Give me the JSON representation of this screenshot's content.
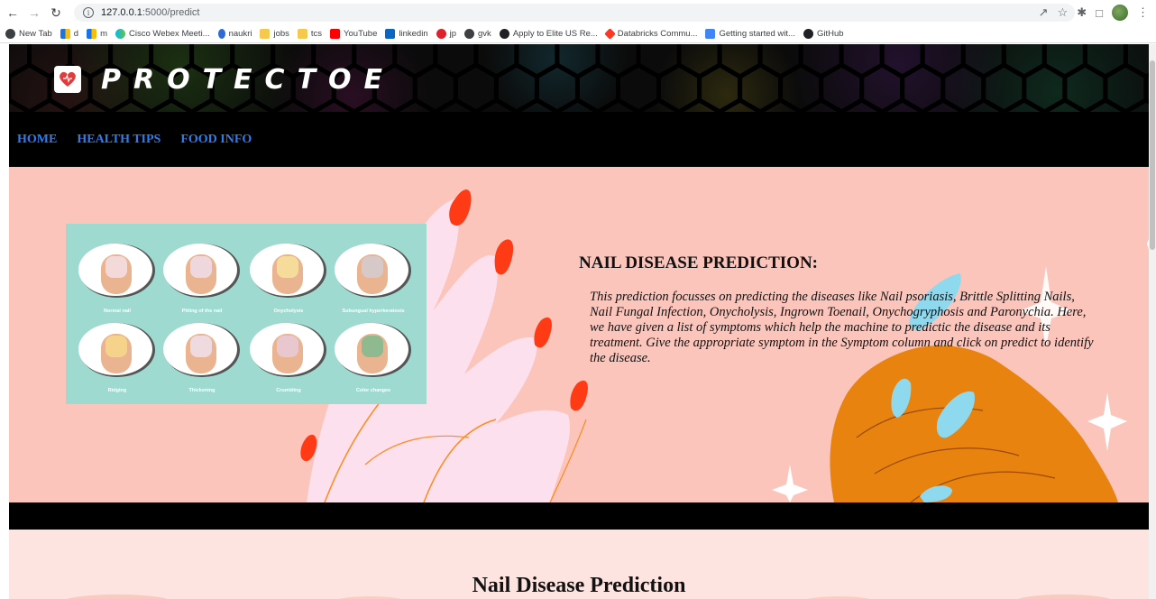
{
  "browser": {
    "url_host": "127.0.0.1",
    "url_path": ":5000/predict",
    "bookmarks": [
      {
        "label": "New Tab",
        "icon": "globe-icon",
        "cls": "globe"
      },
      {
        "label": "d",
        "icon": "meet-icon",
        "cls": "meet"
      },
      {
        "label": "m",
        "icon": "meet-icon",
        "cls": "meet"
      },
      {
        "label": "Cisco Webex Meeti...",
        "icon": "webex-icon",
        "cls": "webex"
      },
      {
        "label": "naukri",
        "icon": "naukri-icon",
        "cls": "naukri"
      },
      {
        "label": "jobs",
        "icon": "folder-icon",
        "cls": "folder"
      },
      {
        "label": "tcs",
        "icon": "folder-icon",
        "cls": "folder"
      },
      {
        "label": "YouTube",
        "icon": "youtube-icon",
        "cls": "youtube"
      },
      {
        "label": "linkedin",
        "icon": "linkedin-icon",
        "cls": "linkedin"
      },
      {
        "label": "jp",
        "icon": "opera-icon",
        "cls": "opera"
      },
      {
        "label": "gvk",
        "icon": "globe-icon",
        "cls": "chrome"
      },
      {
        "label": "Apply to Elite US Re...",
        "icon": "elite-icon",
        "cls": "elite"
      },
      {
        "label": "Databricks Commu...",
        "icon": "databricks-icon",
        "cls": "databricks"
      },
      {
        "label": "Getting started wit...",
        "icon": "docs-icon",
        "cls": "docs"
      },
      {
        "label": "GitHub",
        "icon": "github-icon",
        "cls": "github"
      }
    ]
  },
  "site": {
    "brand": "PROTECTOE",
    "nav": [
      {
        "label": "HOME"
      },
      {
        "label": "HEALTH TIPS"
      },
      {
        "label": "FOOD INFO"
      }
    ]
  },
  "nail_chart": {
    "items": [
      {
        "caption": "Normal nail",
        "nail_color": "#f3d9d9"
      },
      {
        "caption": "Pitting of the nail",
        "nail_color": "#efd8dd"
      },
      {
        "caption": "Onycholysis",
        "nail_color": "#f6dc9a"
      },
      {
        "caption": "Subungual hyperkeratosis",
        "nail_color": "#d8c9c9"
      },
      {
        "caption": "Ridging",
        "nail_color": "#f5d38a"
      },
      {
        "caption": "Thickening",
        "nail_color": "#efdadf"
      },
      {
        "caption": "Crumbling",
        "nail_color": "#e8c7cf"
      },
      {
        "caption": "Color changes",
        "nail_color": "#8fb98e"
      }
    ]
  },
  "hero": {
    "title": "NAIL DISEASE PREDICTION:",
    "description": "This prediction focusses on predicting the diseases like Nail psoriasis, Brittle Splitting Nails, Nail Fungal Infection, Onycholysis, Ingrown Toenail, Onychogryphosis and Paronychia. Here, we have given a list of symptoms which help the machine to predictic the disease and its treatment. Give the appropriate symptom in the Symptom column and click on predict to identify the disease."
  },
  "lower": {
    "title": "Nail Disease Prediction"
  },
  "colors": {
    "nav_link": "#2e7df0",
    "hero_bg": "#fbc5bb",
    "nail_chart_bg": "#9fdad1",
    "lower_bg": "#fde4e1"
  }
}
